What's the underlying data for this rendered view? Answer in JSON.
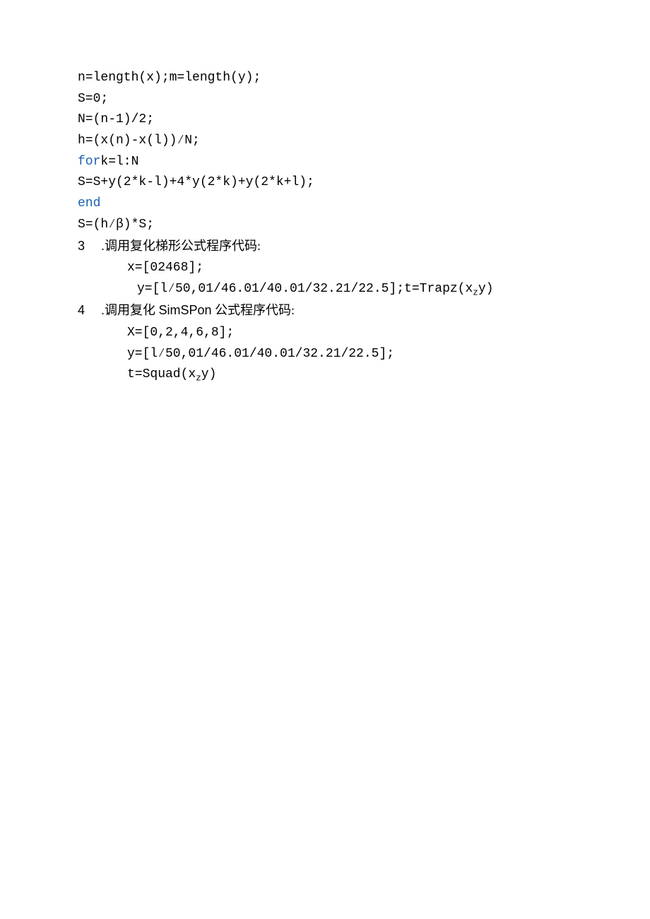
{
  "code1": {
    "l1": "n=length(x);m=length(y);",
    "l2": "S=0;",
    "l3": "N=(n-1)/2;",
    "l4": "h=(x(n)-x(l))∕N;",
    "l5_kw": "for",
    "l5_rest": "k=l:N",
    "l6": "S=S+y(2*k-l)+4*y(2*k)+y(2*k+l);",
    "l7_kw": "end",
    "l8": "S=(h∕β)*S;"
  },
  "section3": {
    "num": "3",
    "dot": " .",
    "title": "调用复化梯形公式程序代码:",
    "l1": "x=[02468];",
    "l2a": "y=[l∕50,01/46.01/40.01/32.21/22.5];t=Trapz(x",
    "l2_sub": "z",
    "l2b": "y)"
  },
  "section4": {
    "num": "4",
    "dot": " .",
    "title_pre": "调用复化 ",
    "title_en": "SimSPon",
    "title_post": " 公式程序代码:",
    "l1": "X=[0,2,4,6,8];",
    "l2": "y=[l∕50,01/46.01/40.01/32.21/22.5];",
    "l3a": "t=Squad(x",
    "l3_sub": "z",
    "l3b": "y)"
  }
}
